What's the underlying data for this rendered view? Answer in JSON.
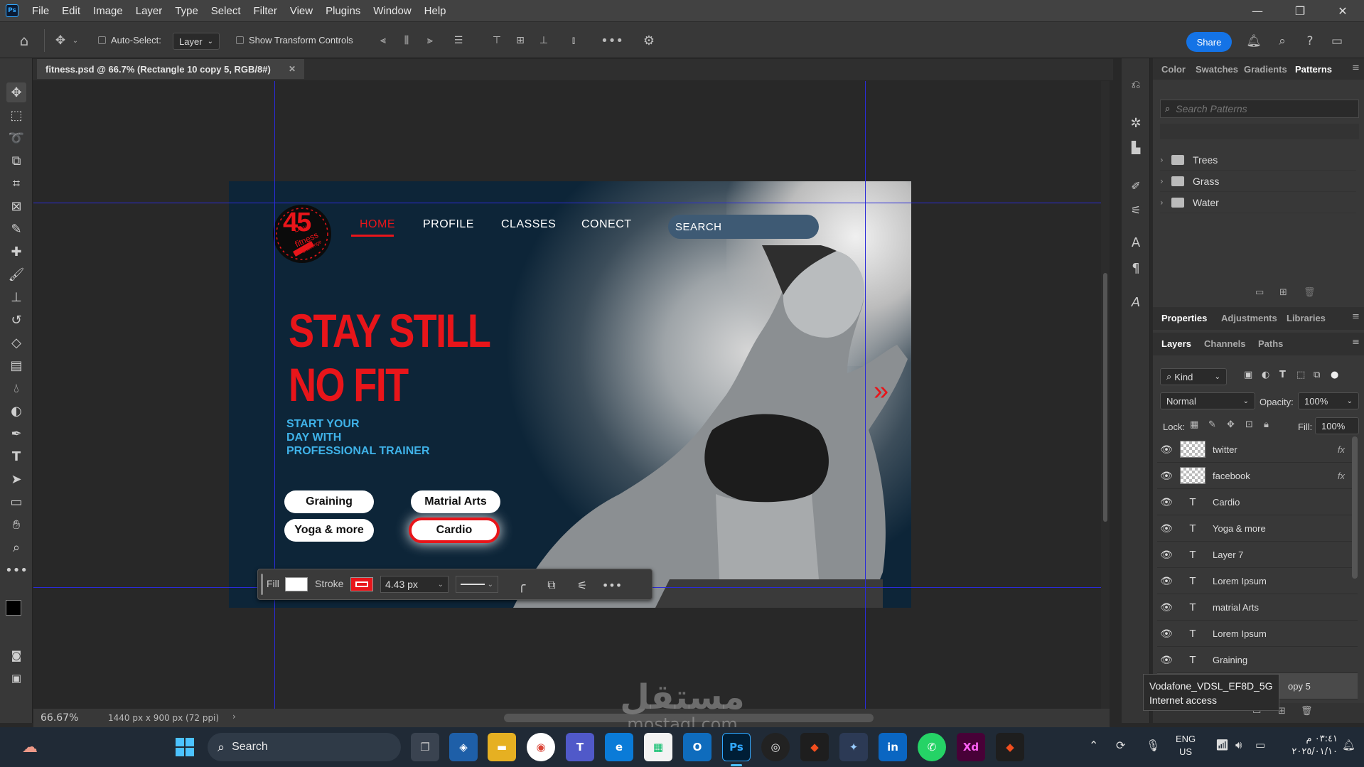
{
  "menubar": {
    "logo": "Ps",
    "items": [
      "File",
      "Edit",
      "Image",
      "Layer",
      "Type",
      "Select",
      "Filter",
      "View",
      "Plugins",
      "Window",
      "Help"
    ]
  },
  "options": {
    "auto_select": "Auto-Select:",
    "layer_dropdown": "Layer",
    "show_transform": "Show Transform Controls",
    "share": "Share"
  },
  "document": {
    "tab_title": "fitness.psd @ 66.7% (Rectangle 10 copy 5, RGB/8#)"
  },
  "design": {
    "logo_number": "45",
    "logo_days": "Days",
    "logo_fitness": "fitness",
    "logo_challenge": "challenge",
    "nav": [
      "HOME",
      "PROFILE",
      "CLASSES",
      "CONECT"
    ],
    "search": "SEARCH",
    "headline_1": "STAY STILL",
    "headline_2": "NO FIT",
    "sub_1": "START YOUR",
    "sub_2": "DAY WITH",
    "sub_3": "PROFESSIONAL TRAINER",
    "buttons": [
      "Graining",
      "Matrial Arts",
      "Yoga & more",
      "Cardio"
    ],
    "arrow": "»",
    "accent_red": "#e8151a",
    "accent_blue": "#3fb2e8",
    "bg_navy": "#0d2538"
  },
  "fillbar": {
    "fill_label": "Fill",
    "stroke_label": "Stroke",
    "stroke_width": "4.43 px"
  },
  "status": {
    "zoom": "66.67%",
    "doc_size": "1440 px x 900 px (72 ppi)"
  },
  "patterns_panel": {
    "tabs": [
      "Color",
      "Swatches",
      "Gradients",
      "Patterns"
    ],
    "search_placeholder": "Search Patterns",
    "folders": [
      "Trees",
      "Grass",
      "Water"
    ]
  },
  "properties_panel": {
    "tabs": [
      "Properties",
      "Adjustments",
      "Libraries"
    ]
  },
  "layers_panel": {
    "tabs": [
      "Layers",
      "Channels",
      "Paths"
    ],
    "kind": "Kind",
    "blend_mode": "Normal",
    "opacity_label": "Opacity:",
    "opacity": "100%",
    "lock_label": "Lock:",
    "fill_label": "Fill:",
    "fill": "100%",
    "fx": "fx",
    "type_glyph": "T",
    "layers": [
      {
        "name": "twitter",
        "kind": "image",
        "fx": true
      },
      {
        "name": "facebook",
        "kind": "image",
        "fx": true
      },
      {
        "name": "Cardio",
        "kind": "text",
        "fx": false
      },
      {
        "name": "Yoga & more",
        "kind": "text",
        "fx": false
      },
      {
        "name": "Layer 7",
        "kind": "text",
        "fx": false
      },
      {
        "name": "Lorem Ipsum",
        "kind": "text",
        "fx": false
      },
      {
        "name": "matrial Arts",
        "kind": "text",
        "fx": false
      },
      {
        "name": "Lorem Ipsum",
        "kind": "text",
        "fx": false
      },
      {
        "name": "Graining",
        "kind": "text",
        "fx": false
      }
    ],
    "partial_layer": "opy 5"
  },
  "tooltip": {
    "line1": "Vodafone_VDSL_EF8D_5G",
    "line2": "Internet access"
  },
  "taskbar": {
    "search": "Search",
    "lang_1": "ENG",
    "lang_2": "US",
    "time": "٠٣:٤١ م",
    "date": "٢٠٢٥/٠١/١٠"
  },
  "watermark": {
    "arabic": "مستقل",
    "latin": "mostaql.com"
  }
}
